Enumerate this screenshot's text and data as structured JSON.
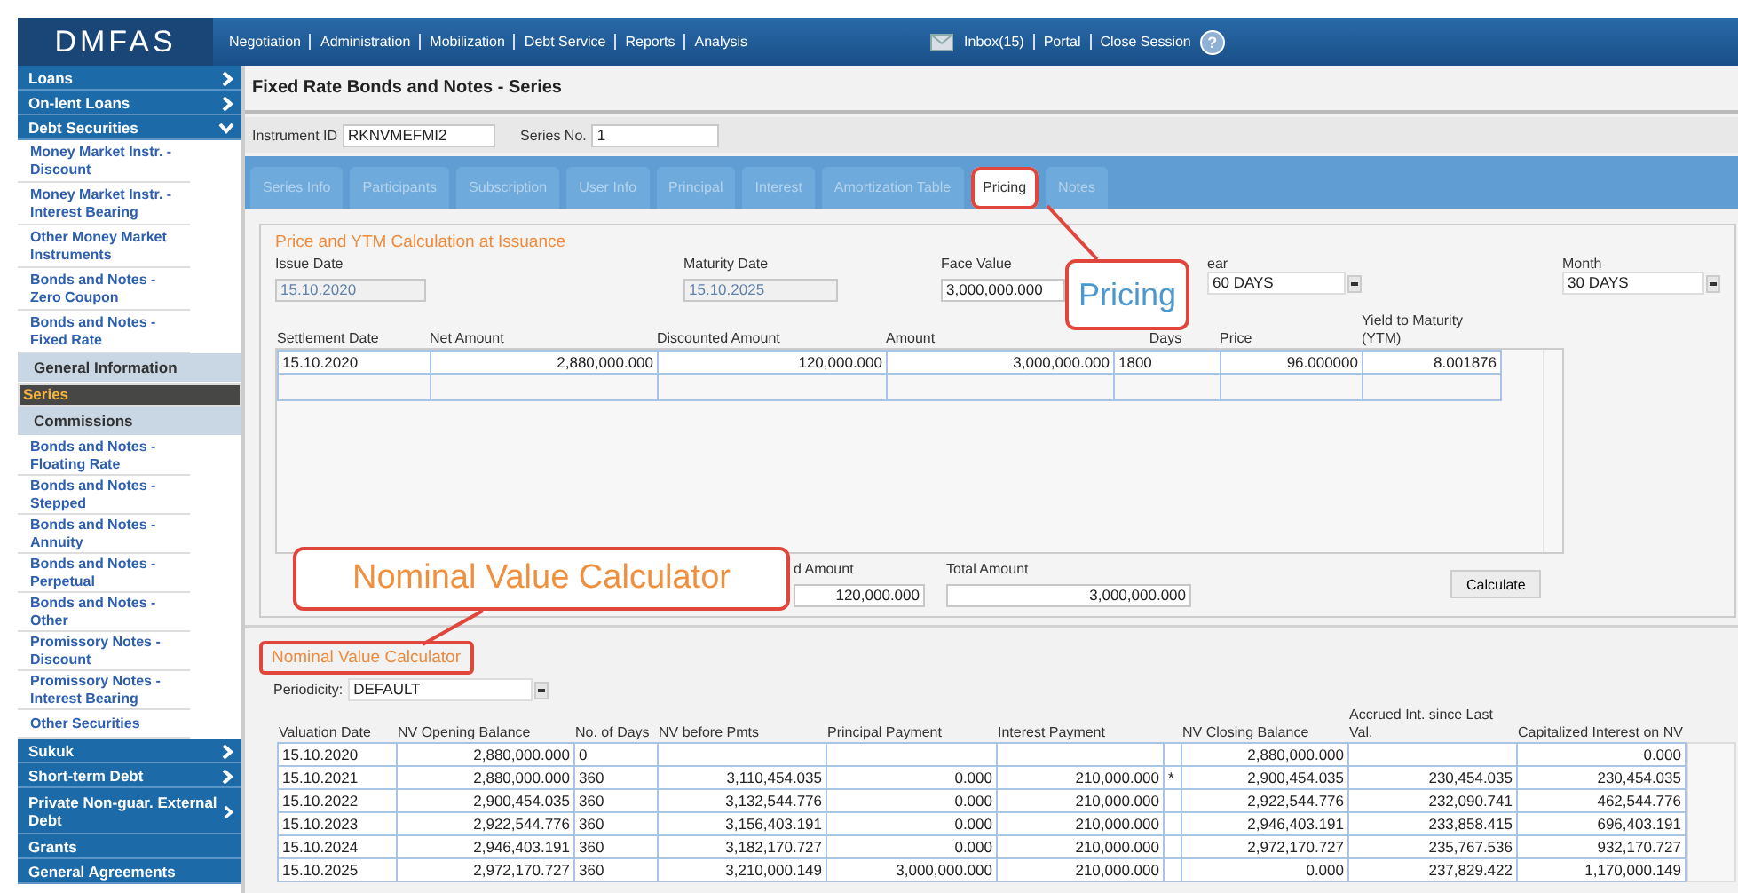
{
  "topbar": {
    "logo": "DMFAS",
    "nav": [
      "Negotiation",
      "Administration",
      "Mobilization",
      "Debt Service",
      "Reports",
      "Analysis"
    ],
    "inbox": "Inbox(15)",
    "links": [
      "Portal",
      "Close Session"
    ],
    "help": "?"
  },
  "sidebar": {
    "items": [
      {
        "label": "Loans",
        "kind": "group",
        "expanded": false
      },
      {
        "label": "On-lent Loans",
        "kind": "group",
        "expanded": false
      },
      {
        "label": "Debt Securities",
        "kind": "group",
        "expanded": true
      },
      {
        "label": "Money Market Instr. - Discount",
        "kind": "item"
      },
      {
        "label": "Money Market Instr. - Interest Bearing",
        "kind": "item"
      },
      {
        "label": "Other Money Market Instruments",
        "kind": "item"
      },
      {
        "label": "Bonds and Notes - Zero Coupon",
        "kind": "item"
      },
      {
        "label": "Bonds and Notes - Fixed Rate",
        "kind": "item"
      },
      {
        "label": "General Information",
        "kind": "sub",
        "selected": false
      },
      {
        "label": "Series",
        "kind": "sub",
        "selected": true
      },
      {
        "label": "Commissions",
        "kind": "sub",
        "selected": false
      },
      {
        "label": "Bonds and Notes - Floating Rate",
        "kind": "item"
      },
      {
        "label": "Bonds and Notes - Stepped",
        "kind": "item"
      },
      {
        "label": "Bonds and Notes - Annuity",
        "kind": "item"
      },
      {
        "label": "Bonds and Notes - Perpetual",
        "kind": "item"
      },
      {
        "label": "Bonds and Notes - Other",
        "kind": "item"
      },
      {
        "label": "Promissory Notes - Discount",
        "kind": "item"
      },
      {
        "label": "Promissory Notes - Interest Bearing",
        "kind": "item"
      },
      {
        "label": "Other Securities",
        "kind": "item"
      },
      {
        "label": "Sukuk",
        "kind": "group",
        "expanded": false
      },
      {
        "label": "Short-term Debt",
        "kind": "group",
        "expanded": false
      },
      {
        "label": "Private Non-guar. External Debt",
        "kind": "group",
        "expanded": false
      },
      {
        "label": "Grants",
        "kind": "link"
      },
      {
        "label": "General Agreements",
        "kind": "link"
      }
    ]
  },
  "page_title": "Fixed Rate Bonds and Notes - Series",
  "instrument": {
    "id_label": "Instrument ID",
    "id_value": "RKNVMEFMI2",
    "series_label": "Series No.",
    "series_value": "1"
  },
  "tabs": [
    {
      "label": "Series Info",
      "selected": false,
      "highlighted": false
    },
    {
      "label": "Participants",
      "selected": false,
      "highlighted": false
    },
    {
      "label": "Subscription",
      "selected": false,
      "highlighted": false
    },
    {
      "label": "User Info",
      "selected": false,
      "highlighted": false
    },
    {
      "label": "Principal",
      "selected": false,
      "highlighted": false
    },
    {
      "label": "Interest",
      "selected": false,
      "highlighted": false
    },
    {
      "label": "Amortization Table",
      "selected": false,
      "highlighted": false
    },
    {
      "label": "Pricing",
      "selected": true,
      "highlighted": true
    },
    {
      "label": "Notes",
      "selected": false,
      "highlighted": false
    }
  ],
  "pricing": {
    "title": "Price and YTM Calculation at Issuance",
    "issue_date": {
      "label": "Issue Date",
      "value": "15.10.2020",
      "disabled": true
    },
    "maturity_date": {
      "label": "Maturity Date",
      "value": "15.10.2025",
      "disabled": true
    },
    "face_value": {
      "label": "Face Value",
      "value": "3,000,000.000"
    },
    "year": {
      "label": "ear",
      "value": "60 DAYS"
    },
    "month": {
      "label": "Month",
      "value": "30 DAYS"
    },
    "columns": [
      "Settlement Date",
      "Net Amount",
      "Discounted Amount",
      "Amount",
      "Days",
      "Price",
      "Yield to Maturity (YTM)"
    ],
    "rows": [
      [
        "15.10.2020",
        "2,880,000.000",
        "120,000.000",
        "3,000,000.000",
        "1800",
        "96.000000",
        "8.001876"
      ]
    ],
    "discount_total": {
      "label": "d Amount",
      "value": "120,000.000"
    },
    "total": {
      "label": "Total Amount",
      "value": "3,000,000.000"
    },
    "calculate": "Calculate"
  },
  "nominal": {
    "title": "Nominal Value Calculator",
    "highlighted": true,
    "periodicity_label": "Periodicity:",
    "periodicity": "DEFAULT",
    "columns": [
      "Valuation Date",
      "NV Opening Balance",
      "No. of Days",
      "NV before Pmts",
      "Principal Payment",
      "Interest Payment",
      "",
      "NV Closing Balance",
      "Accrued Int. since Last Val.",
      "Capitalized Interest on NV"
    ],
    "rows": [
      [
        "15.10.2020",
        "2,880,000.000",
        "0",
        "",
        "",
        "",
        "",
        "2,880,000.000",
        "",
        "0.000"
      ],
      [
        "15.10.2021",
        "2,880,000.000",
        "360",
        "3,110,454.035",
        "0.000",
        "210,000.000",
        "*",
        "2,900,454.035",
        "230,454.035",
        "230,454.035"
      ],
      [
        "15.10.2022",
        "2,900,454.035",
        "360",
        "3,132,544.776",
        "0.000",
        "210,000.000",
        "",
        "2,922,544.776",
        "232,090.741",
        "462,544.776"
      ],
      [
        "15.10.2023",
        "2,922,544.776",
        "360",
        "3,156,403.191",
        "0.000",
        "210,000.000",
        "",
        "2,946,403.191",
        "233,858.415",
        "696,403.191"
      ],
      [
        "15.10.2024",
        "2,946,403.191",
        "360",
        "3,182,170.727",
        "0.000",
        "210,000.000",
        "",
        "2,972,170.727",
        "235,767.536",
        "932,170.727"
      ],
      [
        "15.10.2025",
        "2,972,170.727",
        "360",
        "3,210,000.149",
        "3,000,000.000",
        "210,000.000",
        "",
        "0.000",
        "237,829.422",
        "1,170,000.149"
      ]
    ]
  },
  "annotations": [
    {
      "text": "Pricing"
    },
    {
      "text": "Nominal Value Calculator"
    }
  ]
}
